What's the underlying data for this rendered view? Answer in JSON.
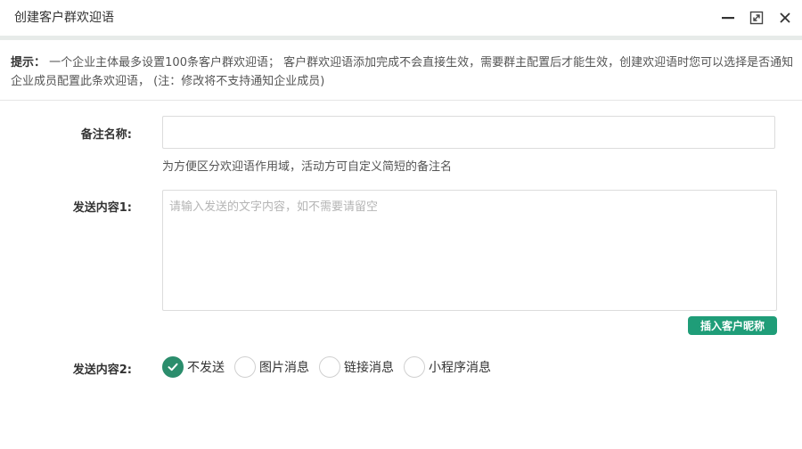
{
  "window": {
    "title": "创建客户群欢迎语",
    "minimize_icon": "minimize-icon",
    "maximize_icon": "maximize-icon",
    "close_icon": "close-icon"
  },
  "tip": {
    "label": "提示：",
    "text": "一个企业主体最多设置100条客户群欢迎语；  客户群欢迎语添加完成不会直接生效，需要群主配置后才能生效，创建欢迎语时您可以选择是否通知企业成员配置此条欢迎语，  (注：修改将不支持通知企业成员)"
  },
  "form": {
    "remark_label": "备注名称:",
    "remark_value": "",
    "remark_hint": "为方便区分欢迎语作用域，活动方可自定义简短的备注名",
    "content1_label": "发送内容1:",
    "content1_placeholder": "请输入发送的文字内容，如不需要请留空",
    "insert_nickname_label": "插入客户昵称",
    "content2_label": "发送内容2:",
    "content2_options": [
      {
        "label": "不发送",
        "checked": true
      },
      {
        "label": "图片消息",
        "checked": false
      },
      {
        "label": "链接消息",
        "checked": false
      },
      {
        "label": "小程序消息",
        "checked": false
      }
    ]
  },
  "colors": {
    "accent": "#2b8d6c",
    "button": "#1f9d78"
  }
}
